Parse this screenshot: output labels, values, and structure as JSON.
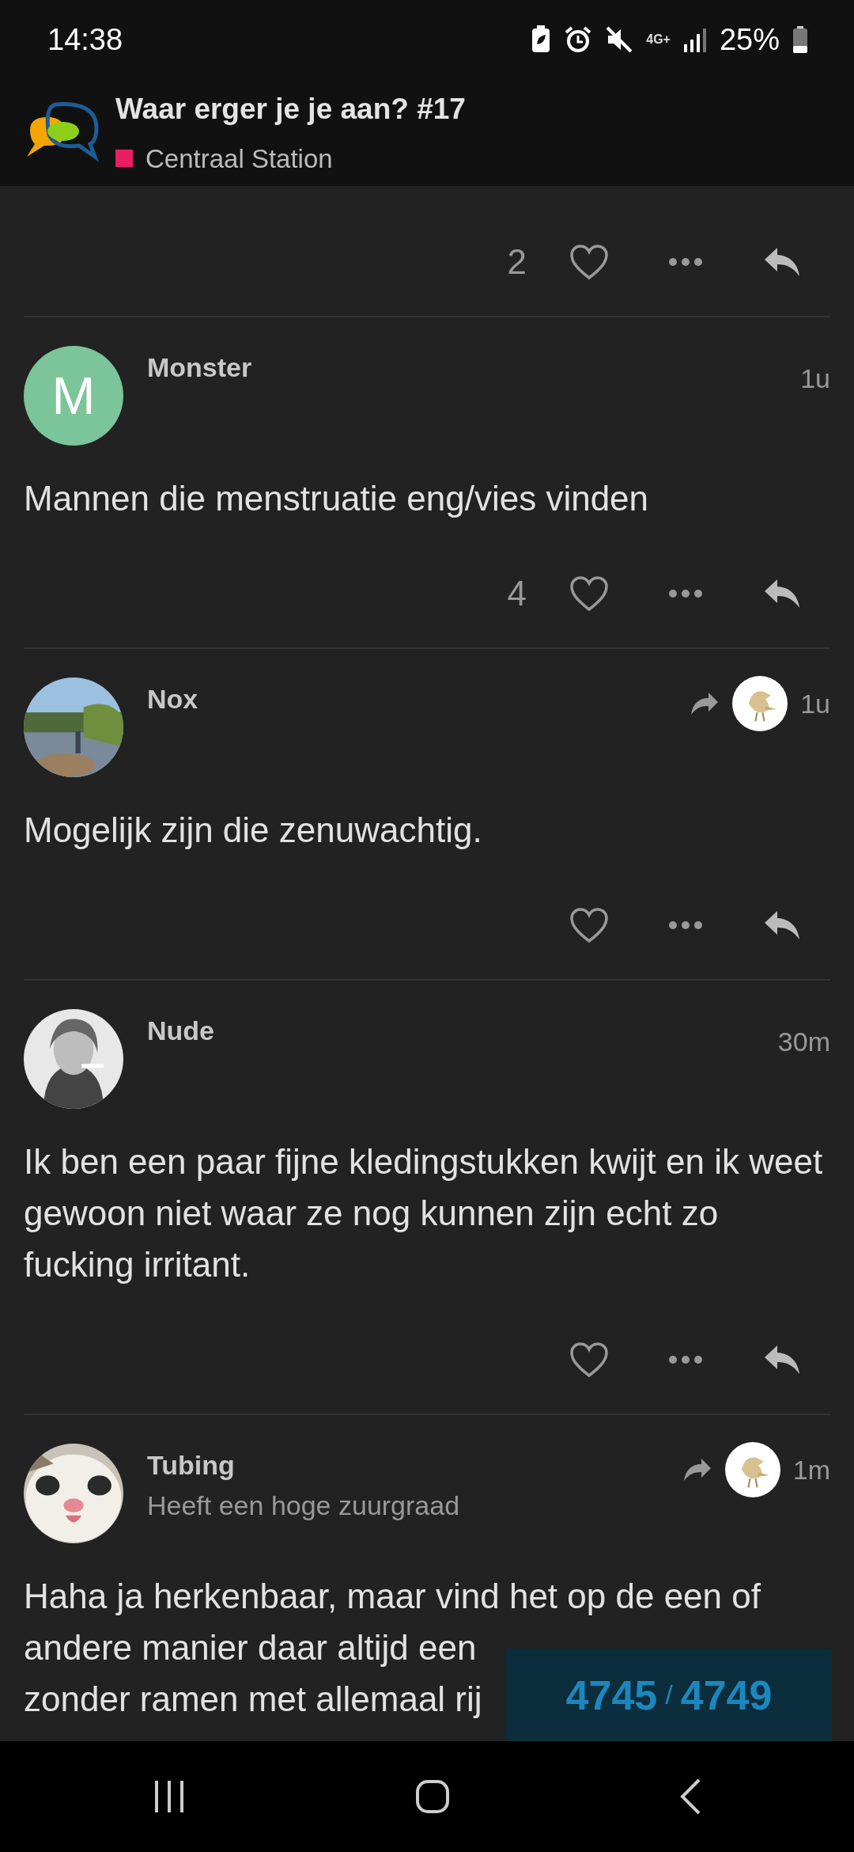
{
  "status_bar": {
    "time": "14:38",
    "network": "4G+",
    "battery": "25%"
  },
  "header": {
    "title": "Waar erger je je aan? #17",
    "category": {
      "name": "Centraal Station",
      "color": "#e91e63"
    }
  },
  "previous_post_actions": {
    "likes": "2"
  },
  "posts": [
    {
      "author": "Monster",
      "time": "1u",
      "avatar": {
        "kind": "letter",
        "letter": "M",
        "color": "#7cc49a"
      },
      "reply_to": false,
      "body": [
        "Mannen die menstruatie eng/vies vinden"
      ],
      "likes": "4"
    },
    {
      "author": "Nox",
      "time": "1u",
      "avatar": {
        "kind": "picture"
      },
      "reply_to": true,
      "body": [
        "Mogelijk zijn die zenuwachtig."
      ]
    },
    {
      "author": "Nude",
      "time": "30m",
      "avatar": {
        "kind": "picture"
      },
      "reply_to": false,
      "body": [
        "Ik ben een paar fijne kledingstukken kwijt en ik weet gewoon niet waar ze nog kunnen zijn echt zo fucking irritant."
      ]
    },
    {
      "author": "Tubing",
      "subtitle": "Heeft een hoge zuurgraad",
      "time": "1m",
      "avatar": {
        "kind": "picture"
      },
      "reply_to": true,
      "body": [
        "Haha ja herkenbaar, maar vind het op de een of",
        "andere manier daar altijd een",
        "zonder ramen met allemaal rij"
      ]
    }
  ],
  "progress": {
    "current": "4745",
    "separator": "/",
    "total": "4749"
  }
}
